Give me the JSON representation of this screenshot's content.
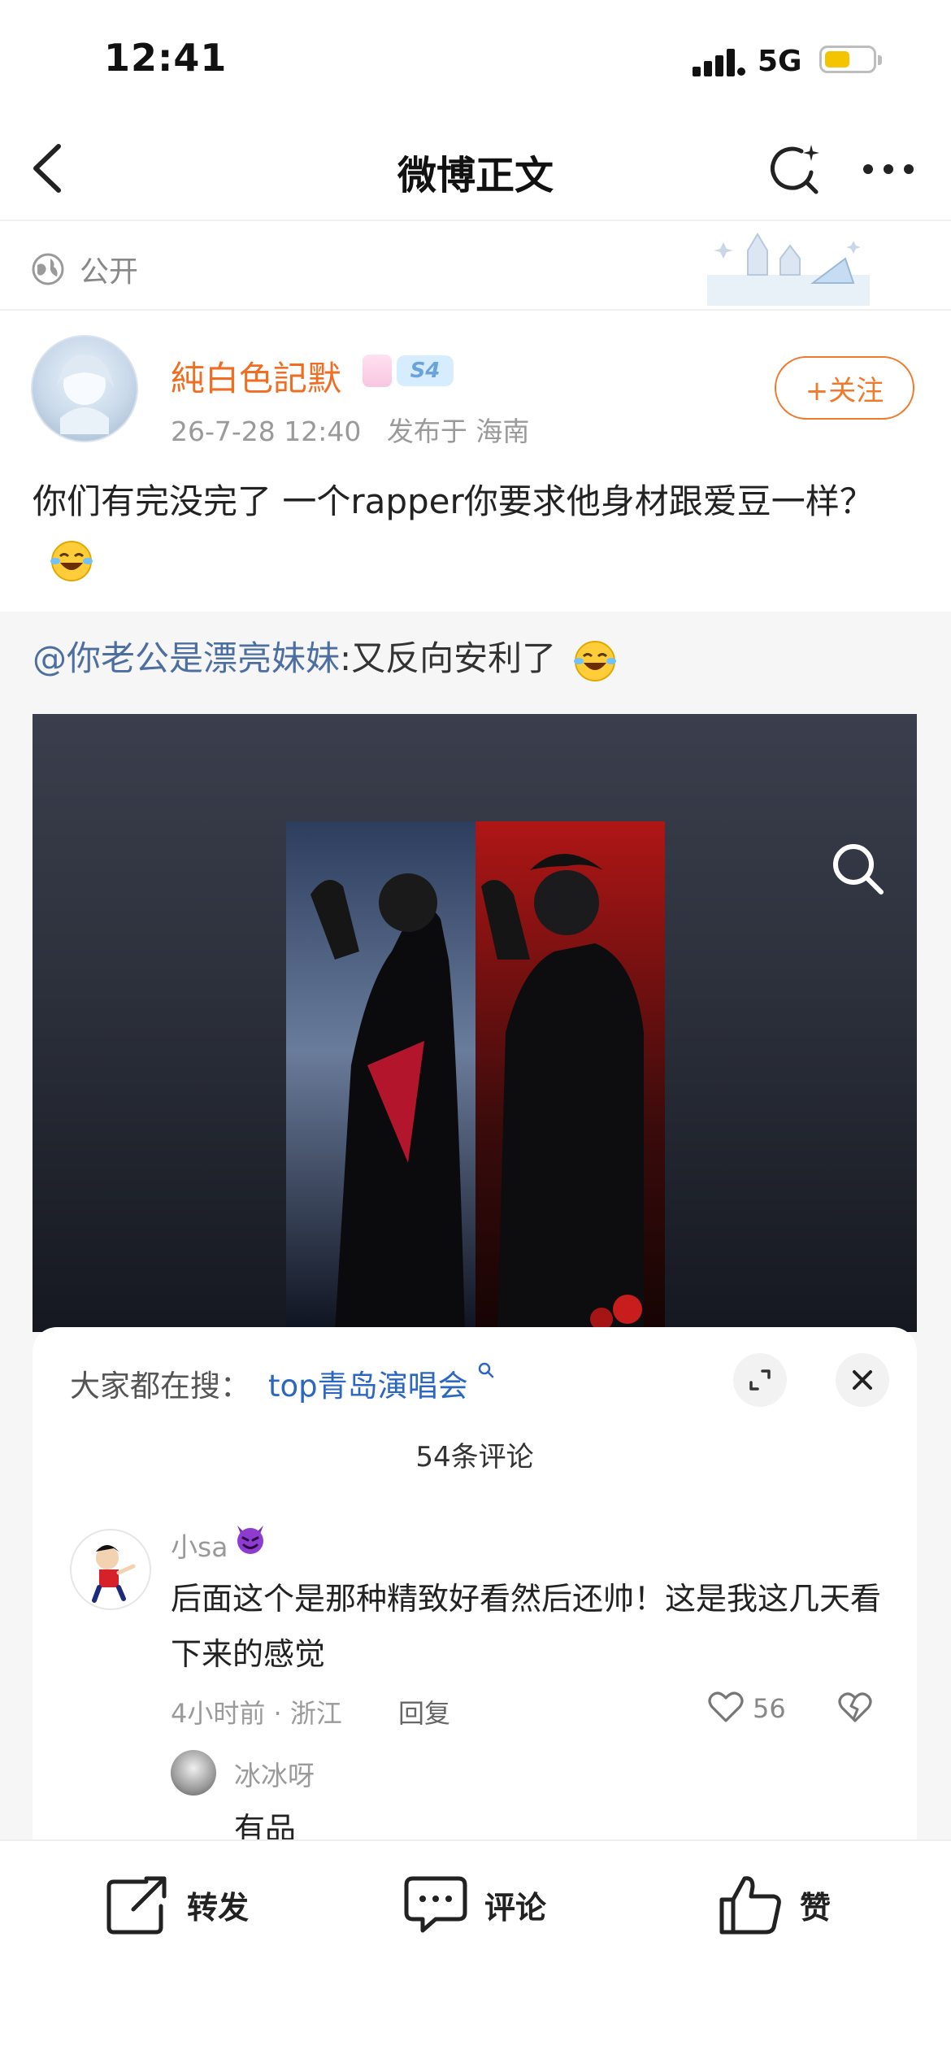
{
  "status_bar": {
    "time": "12:41",
    "network": "5G",
    "battery_color": "#f5c400"
  },
  "nav": {
    "title": "微博正文",
    "back_icon": "chevron-left-icon",
    "refresh_icon": "refresh-sparkle-icon",
    "more_icon": "more-dots-icon"
  },
  "visibility": {
    "label": "公开",
    "icon": "globe-icon"
  },
  "post": {
    "username": "純白色記默",
    "username_color": "#f06d22",
    "level_badge": "S4",
    "meta": "26-7-28 12:40   发布于 海南",
    "follow_label": "+关注",
    "text": "你们有完没完了 一个rapper你要求他身材跟爱豆一样？",
    "emoji": "laugh-cry-emoji"
  },
  "repost": {
    "mention": "@你老公是漂亮妹妹",
    "text": ":又反向安利了",
    "emoji": "laugh-cry-emoji",
    "mention_color": "#4d6ea0"
  },
  "comments_sheet": {
    "trend_label": "大家都在搜：",
    "trend_query": "top青岛演唱会",
    "count_label": "54条评论",
    "comment": {
      "user": "小sa",
      "user_emoji": "purple-devil-emoji",
      "text": "后面这个是那种精致好看然后还帅！这是我这几天看下来的感觉",
      "time": "4小时前 · 浙江",
      "reply_label": "回复",
      "likes": "56"
    },
    "reply": {
      "user": "冰冰呀",
      "text": "有品"
    }
  },
  "bottom_bar": {
    "repost": "转发",
    "comment": "评论",
    "like": "赞"
  }
}
